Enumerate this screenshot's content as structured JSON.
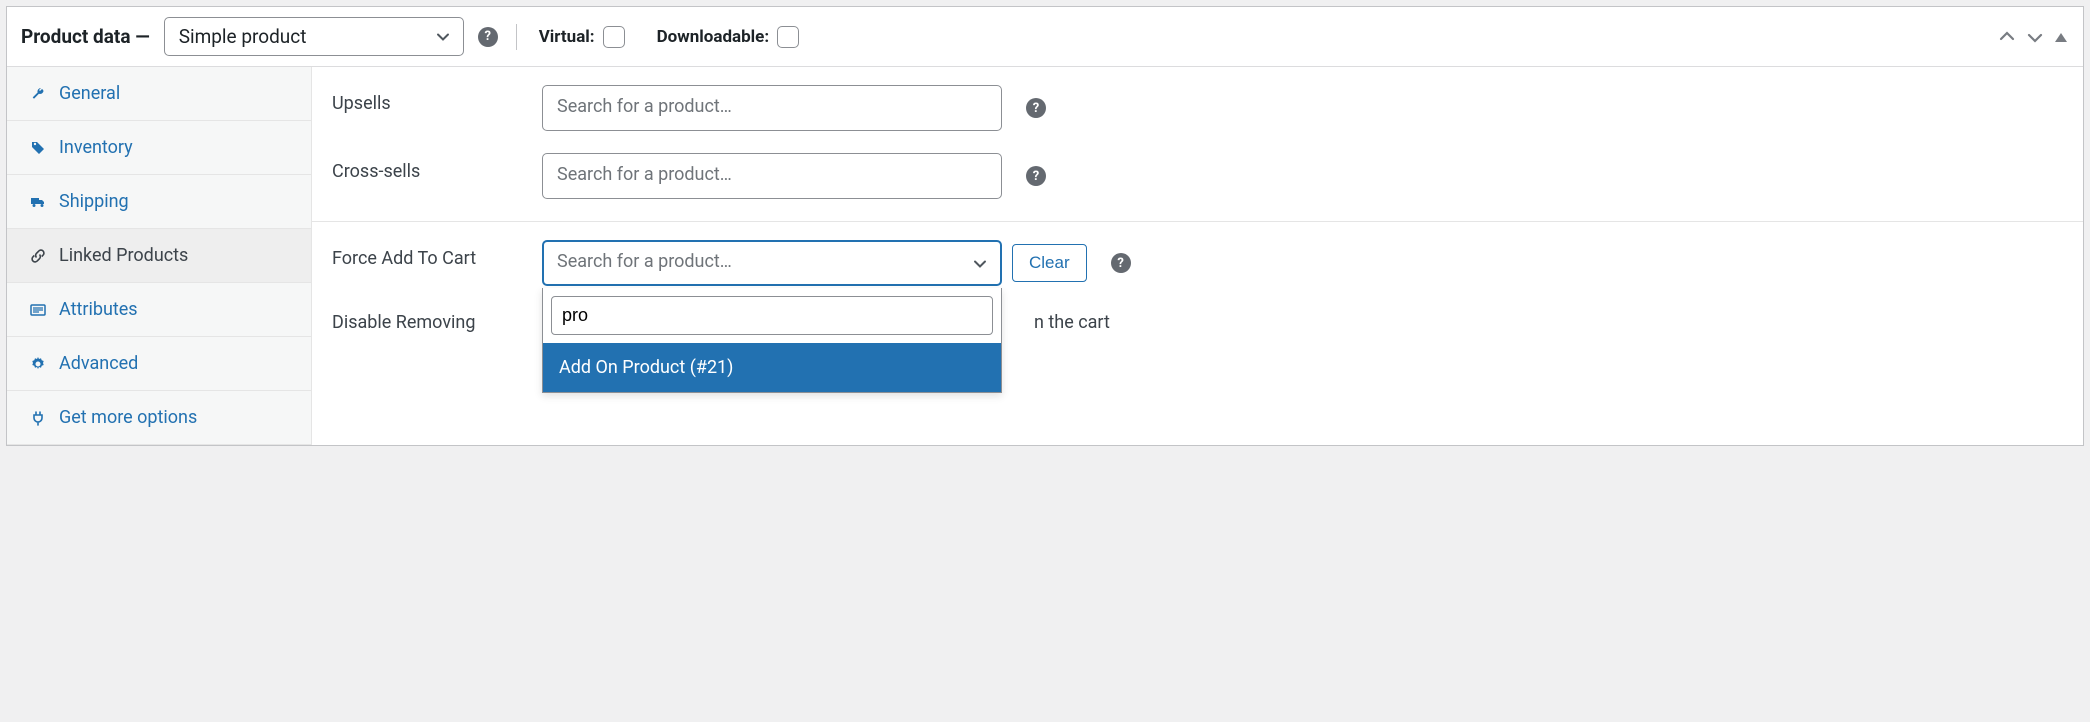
{
  "header": {
    "title_prefix": "Product data —",
    "product_type": "Simple product",
    "virtual_label": "Virtual:",
    "downloadable_label": "Downloadable:"
  },
  "sidebar": {
    "items": [
      {
        "key": "general",
        "label": "General",
        "icon": "wrench-icon",
        "active": false
      },
      {
        "key": "inventory",
        "label": "Inventory",
        "icon": "tag-icon",
        "active": false
      },
      {
        "key": "shipping",
        "label": "Shipping",
        "icon": "truck-icon",
        "active": false
      },
      {
        "key": "linked",
        "label": "Linked Products",
        "icon": "link-icon",
        "active": true
      },
      {
        "key": "attributes",
        "label": "Attributes",
        "icon": "list-icon",
        "active": false
      },
      {
        "key": "advanced",
        "label": "Advanced",
        "icon": "gear-icon",
        "active": false
      },
      {
        "key": "getmore",
        "label": "Get more options",
        "icon": "plug-icon",
        "active": false
      }
    ]
  },
  "content": {
    "upsells": {
      "label": "Upsells",
      "placeholder": "Search for a product…"
    },
    "cross_sells": {
      "label": "Cross-sells",
      "placeholder": "Search for a product…"
    },
    "force_add": {
      "label": "Force Add To Cart",
      "placeholder": "Search for a product…",
      "search_value": "pro",
      "clear_label": "Clear",
      "results": [
        "Add On Product (#21)"
      ]
    },
    "disable_removing": {
      "label": "Disable Removing",
      "trailing_text": "n the cart"
    }
  }
}
